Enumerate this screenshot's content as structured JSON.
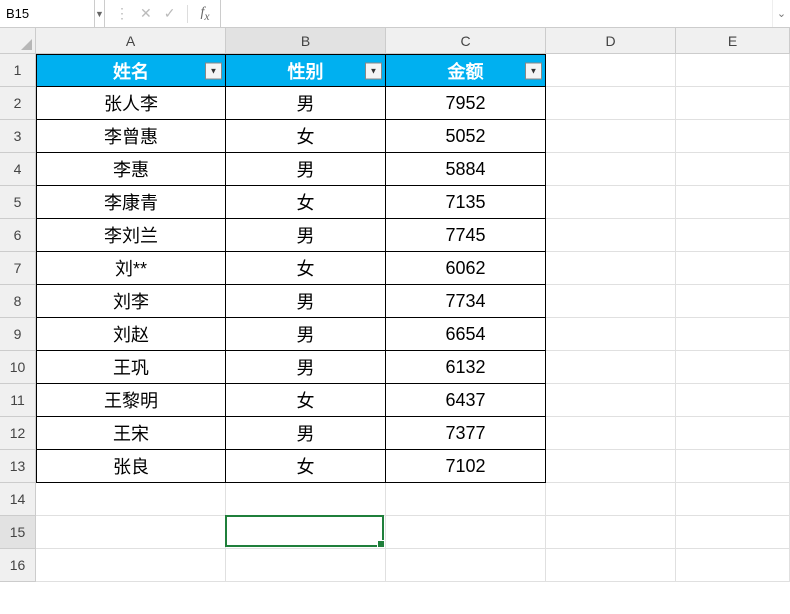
{
  "formula_bar": {
    "name_box_value": "B15",
    "formula_value": ""
  },
  "columns": {
    "A": "A",
    "B": "B",
    "C": "C",
    "D": "D",
    "E": "E"
  },
  "header_row": {
    "name": "姓名",
    "gender": "性别",
    "amount": "金额"
  },
  "rows": [
    {
      "name": "张人李",
      "gender": "男",
      "amount": "7952"
    },
    {
      "name": "李曾惠",
      "gender": "女",
      "amount": "5052"
    },
    {
      "name": "李惠",
      "gender": "男",
      "amount": "5884"
    },
    {
      "name": "李康青",
      "gender": "女",
      "amount": "7135"
    },
    {
      "name": "李刘兰",
      "gender": "男",
      "amount": "7745"
    },
    {
      "name": "刘**",
      "gender": "女",
      "amount": "6062"
    },
    {
      "name": "刘李",
      "gender": "男",
      "amount": "7734"
    },
    {
      "name": "刘赵",
      "gender": "男",
      "amount": "6654"
    },
    {
      "name": "王巩",
      "gender": "男",
      "amount": "6132"
    },
    {
      "name": "王黎明",
      "gender": "女",
      "amount": "6437"
    },
    {
      "name": "王宋",
      "gender": "男",
      "amount": "7377"
    },
    {
      "name": "张良",
      "gender": "女",
      "amount": "7102"
    }
  ],
  "row_numbers": [
    "1",
    "2",
    "3",
    "4",
    "5",
    "6",
    "7",
    "8",
    "9",
    "10",
    "11",
    "12",
    "13",
    "14",
    "15",
    "16"
  ],
  "active_cell": {
    "row": 15,
    "col": "B"
  },
  "chart_data": {
    "type": "table",
    "columns": [
      "姓名",
      "性别",
      "金额"
    ],
    "data": [
      [
        "张人李",
        "男",
        7952
      ],
      [
        "李曾惠",
        "女",
        5052
      ],
      [
        "李惠",
        "男",
        5884
      ],
      [
        "李康青",
        "女",
        7135
      ],
      [
        "李刘兰",
        "男",
        7745
      ],
      [
        "刘**",
        "女",
        6062
      ],
      [
        "刘李",
        "男",
        7734
      ],
      [
        "刘赵",
        "男",
        6654
      ],
      [
        "王巩",
        "男",
        6132
      ],
      [
        "王黎明",
        "女",
        6437
      ],
      [
        "王宋",
        "男",
        7377
      ],
      [
        "张良",
        "女",
        7102
      ]
    ]
  }
}
